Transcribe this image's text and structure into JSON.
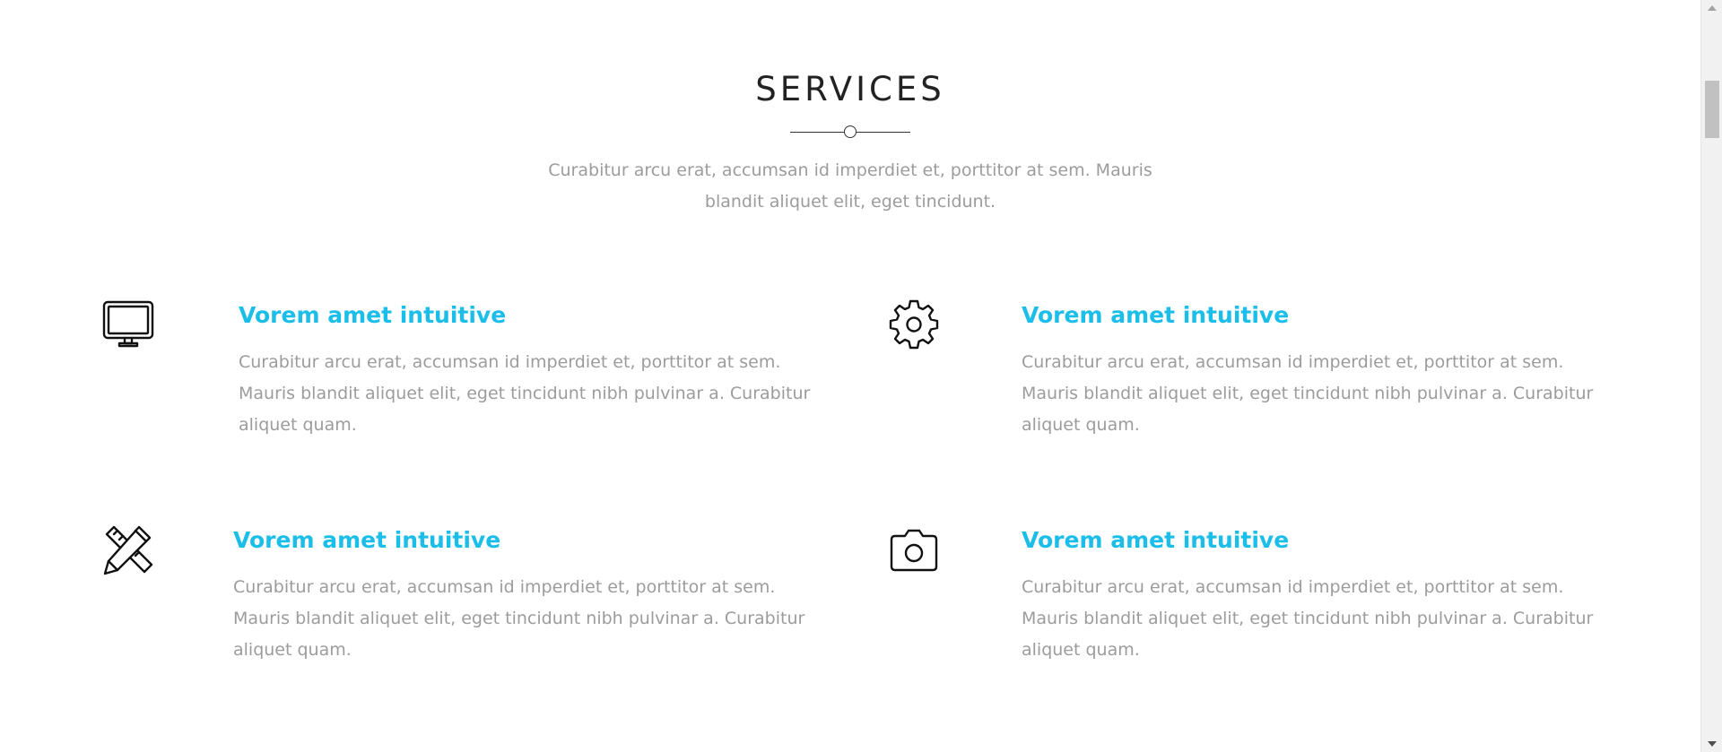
{
  "section": {
    "title": "SERVICES",
    "subtitle": "Curabitur arcu erat, accumsan id imperdiet et, porttitor at sem. Mauris blandit aliquet elit, eget tincidunt."
  },
  "services": [
    {
      "icon": "monitor-icon",
      "title": "Vorem amet intuitive",
      "description": "Curabitur arcu erat, accumsan id imperdiet et, porttitor at sem. Mauris blandit aliquet elit, eget tincidunt nibh pulvinar a. Curabitur aliquet quam."
    },
    {
      "icon": "gear-icon",
      "title": "Vorem amet intuitive",
      "description": "Curabitur arcu erat, accumsan id imperdiet et, porttitor at sem. Mauris blandit aliquet elit, eget tincidunt nibh pulvinar a. Curabitur aliquet quam."
    },
    {
      "icon": "pencil-ruler-icon",
      "title": "Vorem amet intuitive",
      "description": "Curabitur arcu erat, accumsan id imperdiet et, porttitor at sem. Mauris blandit aliquet elit, eget tincidunt nibh pulvinar a. Curabitur aliquet quam."
    },
    {
      "icon": "camera-icon",
      "title": "Vorem amet intuitive",
      "description": "Curabitur arcu erat, accumsan id imperdiet et, porttitor at sem. Mauris blandit aliquet elit, eget tincidunt nibh pulvinar a. Curabitur aliquet quam."
    }
  ],
  "colors": {
    "accent": "#1bbde9",
    "body_text": "#9c9c9c",
    "heading": "#222222"
  }
}
